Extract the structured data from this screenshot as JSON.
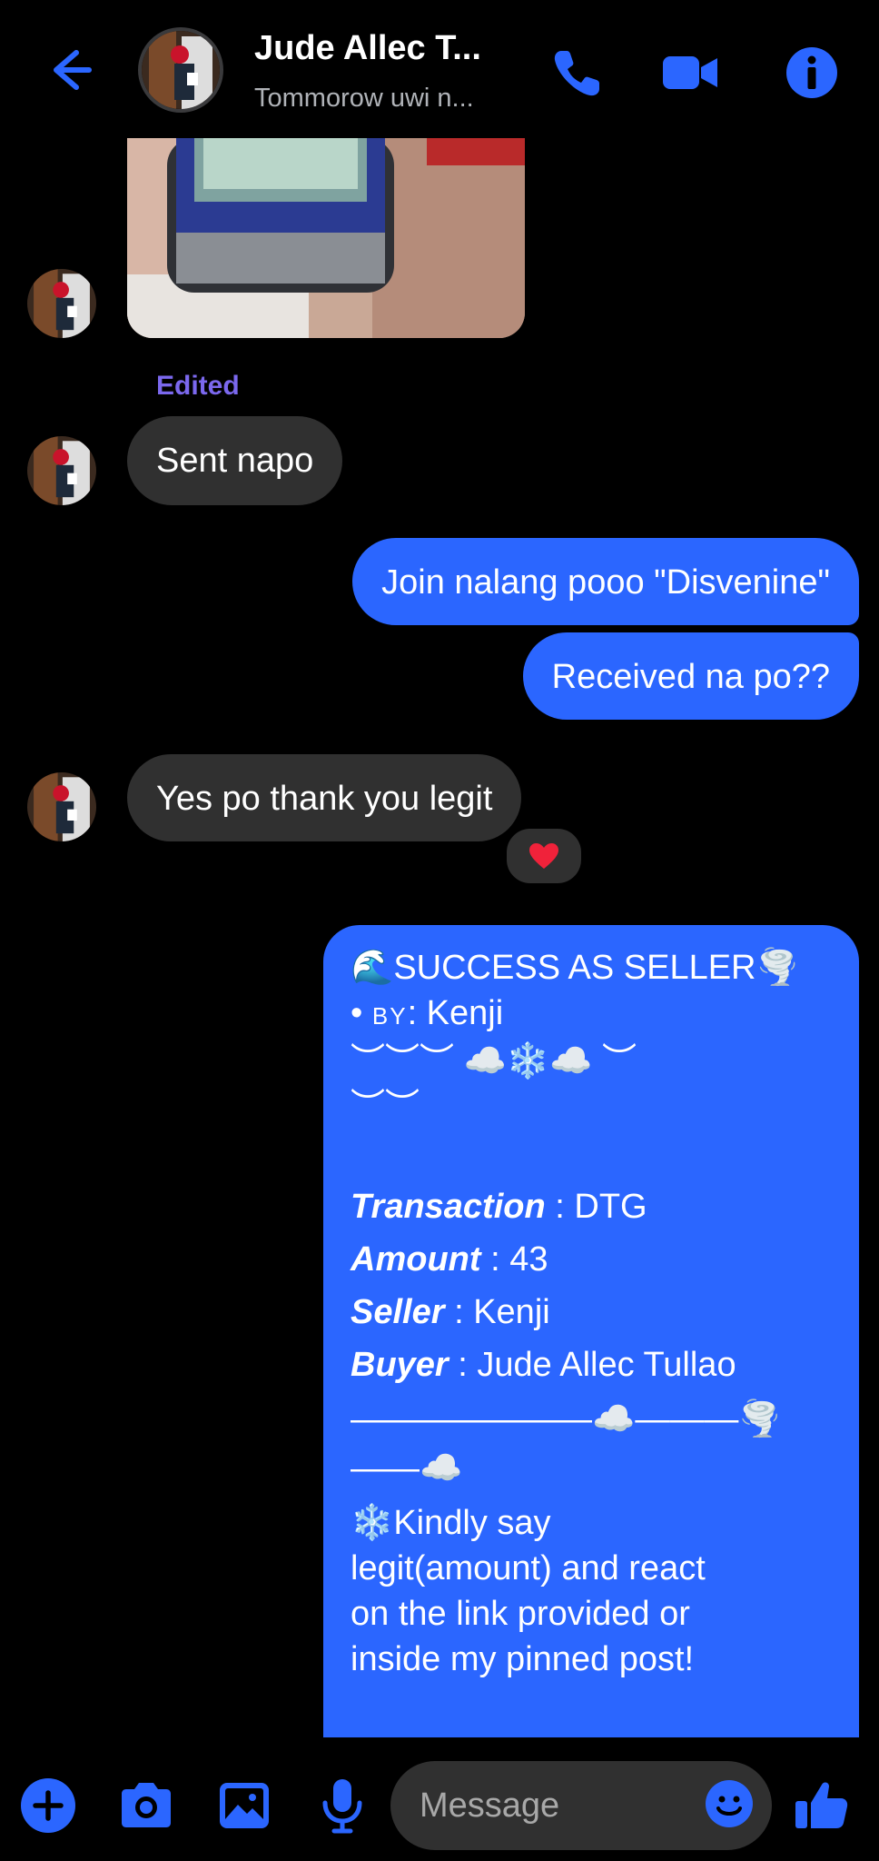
{
  "header": {
    "title": "Jude Allec T...",
    "subtitle": "Tommorow uwi n...",
    "accent": "#2b66ff"
  },
  "messages": {
    "edited_label": "Edited",
    "m1": "Sent napo",
    "m2": "Join nalang pooo \"Disvenine\"",
    "m3": "Received na po??",
    "m4": "Yes po thank you legit",
    "m4_reaction": "❤️"
  },
  "receipt": {
    "title_emoji_left": "🌊",
    "title": "SUCCESS AS SELLER",
    "title_emoji_right": "🌪️",
    "by_bullet": "•",
    "by_label": "BY",
    "by_value": ": Kenji",
    "deco1": "︶︶︶ ☁️❄️☁️ ︶",
    "deco2": "︶︶",
    "transaction_label": "Transaction",
    "transaction_value": " : DTG",
    "amount_label": "Amount",
    "amount_value": " : 43",
    "seller_label": "Seller",
    "seller_value": " : Kenji",
    "buyer_label": "Buyer",
    "buyer_value": " : Jude Allec Tullao",
    "divider1": "———————☁️———🌪️",
    "divider2": "——☁️",
    "note1": "❄️Kindly say",
    "note2": "legit(amount) and react",
    "note3": "on the link provided or",
    "note4": "inside my pinned post!"
  },
  "composer": {
    "placeholder": "Message"
  },
  "icons": {
    "back": "back-arrow-icon",
    "call": "phone-icon",
    "video": "video-camera-icon",
    "info": "info-icon",
    "plus": "plus-icon",
    "camera": "camera-icon",
    "gallery": "gallery-icon",
    "mic": "microphone-icon",
    "emoji": "emoji-icon",
    "like": "thumbs-up-icon"
  }
}
